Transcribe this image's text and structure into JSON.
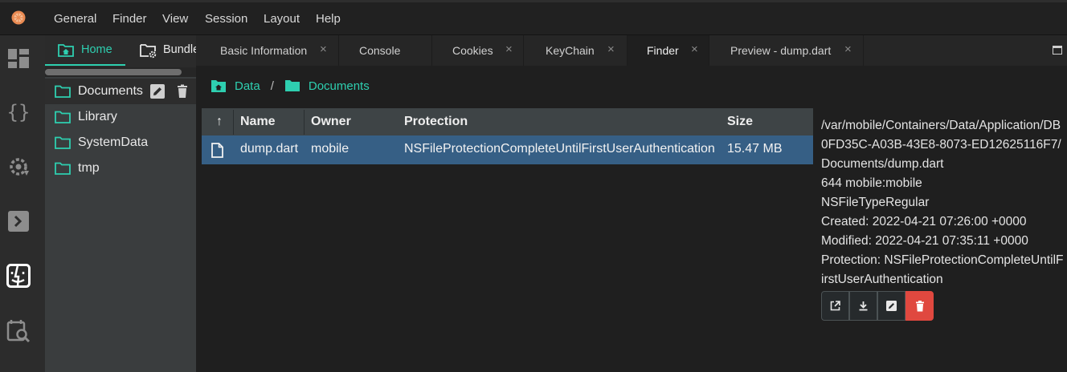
{
  "menu": [
    "General",
    "Finder",
    "View",
    "Session",
    "Layout",
    "Help"
  ],
  "activity_icons": [
    "dashboard-icon",
    "braces-icon",
    "settings-sync-icon",
    "terminal-icon",
    "finder-icon",
    "inspect-icon"
  ],
  "sidebar": {
    "tabs": [
      {
        "label": "Home",
        "icon": "home-folder-icon"
      },
      {
        "label": "Bundle",
        "icon": "folder-gear-icon"
      }
    ],
    "items": [
      {
        "label": "Documents"
      },
      {
        "label": "Library"
      },
      {
        "label": "SystemData"
      },
      {
        "label": "tmp"
      }
    ]
  },
  "tabs": [
    {
      "label": "Basic Information",
      "closable": true
    },
    {
      "label": "Console",
      "closable": false
    },
    {
      "label": "Cookies",
      "closable": true
    },
    {
      "label": "KeyChain",
      "closable": true
    },
    {
      "label": "Finder",
      "closable": true,
      "active": true
    },
    {
      "label": "Preview - dump.dart",
      "closable": true
    }
  ],
  "tab_close_glyph": "×",
  "breadcrumb": {
    "root": "Data",
    "separator": "/",
    "current": "Documents"
  },
  "table": {
    "sort_glyph": "↑",
    "headers": {
      "name": "Name",
      "owner": "Owner",
      "protection": "Protection",
      "size": "Size"
    },
    "rows": [
      {
        "name": "dump.dart",
        "owner": "mobile",
        "protection": "NSFileProtectionCompleteUntilFirstUserAuthentication",
        "size": "15.47 MB"
      }
    ]
  },
  "details": {
    "path": "/var/mobile/Containers/Data/Application/DB0FD35C-A03B-43E8-8073-ED12625116F7/Documents/dump.dart",
    "perm": "644 mobile:mobile",
    "type": "NSFileTypeRegular",
    "created": "Created: 2022-04-21 07:26:00 +0000",
    "modified": "Modified: 2022-04-21 07:35:11 +0000",
    "protection": "Protection: NSFileProtectionCompleteUntilFirstUserAuthentication"
  },
  "colors": {
    "accent": "#2ecfb0",
    "selection": "#365f85",
    "danger": "#e0483f"
  }
}
